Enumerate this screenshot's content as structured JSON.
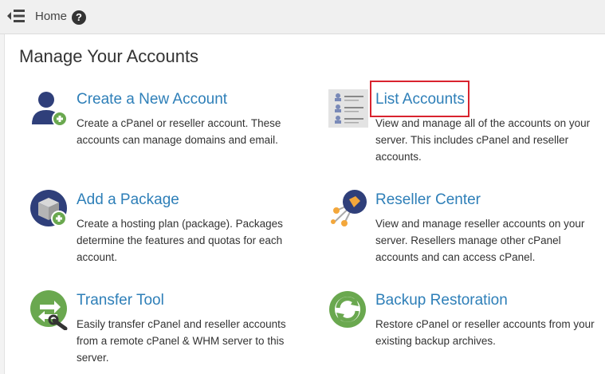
{
  "header": {
    "breadcrumb": "Home",
    "help_glyph": "?"
  },
  "page": {
    "title": "Manage Your Accounts"
  },
  "cards": [
    {
      "title": "Create a New Account",
      "description": "Create a cPanel or reseller account. These accounts can manage domains and email.",
      "icon": "user-add-icon"
    },
    {
      "title": "List Accounts",
      "description": "View and manage all of the accounts on your server. This includes cPanel and reseller accounts.",
      "icon": "account-list-icon"
    },
    {
      "title": "Add a Package",
      "description": "Create a hosting plan (package). Packages determine the features and quotas for each account.",
      "icon": "package-add-icon"
    },
    {
      "title": "Reseller Center",
      "description": "View and manage reseller accounts on your server. Resellers manage other cPanel accounts and can access cPanel.",
      "icon": "reseller-network-icon"
    },
    {
      "title": "Transfer Tool",
      "description": "Easily transfer cPanel and reseller accounts from a remote cPanel & WHM server to this server.",
      "icon": "transfer-tool-icon"
    },
    {
      "title": "Backup Restoration",
      "description": "Restore cPanel or reseller accounts from your existing backup archives.",
      "icon": "backup-restore-icon"
    }
  ],
  "colors": {
    "link": "#2e7fb8",
    "highlight": "#d9232e",
    "green": "#6aa84f",
    "navy": "#2f3f7a"
  }
}
